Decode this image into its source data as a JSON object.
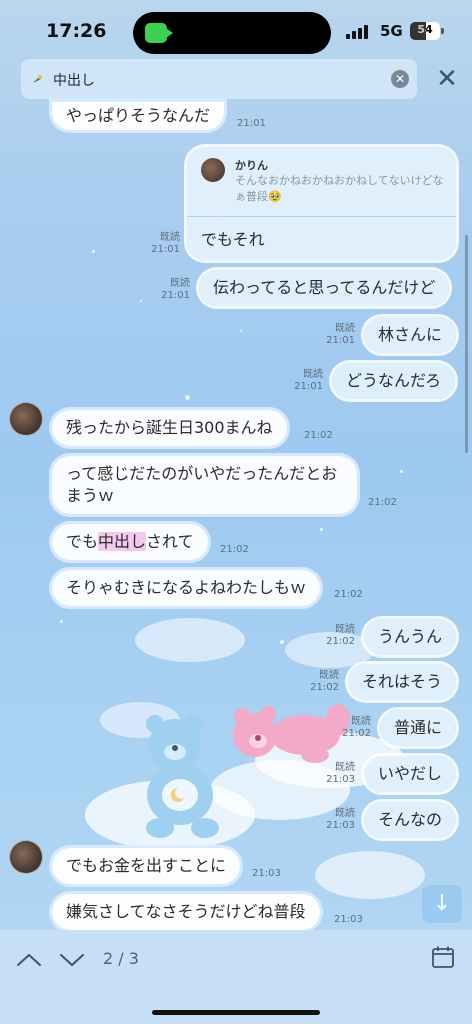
{
  "status_bar": {
    "time": "17:26",
    "network": "5G",
    "battery": "54"
  },
  "search": {
    "query": "中出し"
  },
  "reply": {
    "quoted_name": "かりん",
    "quoted_text": "そんなおかねおかねおかねしてないけどなぁ普段🥹",
    "text": "でもそれ",
    "status": "既読",
    "time": "21:01"
  },
  "messages": [
    {
      "side": "left",
      "text": "やっぱりそうなんだ",
      "time": "21:01"
    },
    {
      "side": "right",
      "text": "伝わってると思ってるんだけど",
      "status": "既読",
      "time": "21:01"
    },
    {
      "side": "right",
      "text": "林さんに",
      "status": "既読",
      "time": "21:01"
    },
    {
      "side": "right",
      "text": "どうなんだろ",
      "status": "既読",
      "time": "21:01"
    },
    {
      "side": "left",
      "text": "残ったから誕生日300まんね",
      "time": "21:02"
    },
    {
      "side": "left",
      "text": "って感じだたのがいやだったんだとおまうｗ",
      "time": "21:02"
    },
    {
      "side": "left",
      "text_before": "でも",
      "text_highlight": "中出し",
      "text_after": "されて",
      "time": "21:02"
    },
    {
      "side": "left",
      "text": "そりゃむきになるよねわたしもｗ",
      "time": "21:02"
    },
    {
      "side": "right",
      "text": "うんうん",
      "status": "既読",
      "time": "21:02"
    },
    {
      "side": "right",
      "text": "それはそう",
      "status": "既読",
      "time": "21:02"
    },
    {
      "side": "right",
      "text": "普通に",
      "status": "既読",
      "time": "21:02"
    },
    {
      "side": "right",
      "text": "いやだし",
      "status": "既読",
      "time": "21:03"
    },
    {
      "side": "right",
      "text": "そんなの",
      "status": "既読",
      "time": "21:03"
    },
    {
      "side": "left",
      "text": "でもお金を出すことに",
      "time": "21:03"
    },
    {
      "side": "left",
      "text": "嫌気さしてなさそうだけどね普段",
      "time": "21:03"
    }
  ],
  "pager": {
    "label": "2 / 3"
  },
  "colors": {
    "accent": "#8fc3ee",
    "highlight": "#f3c9ee"
  }
}
